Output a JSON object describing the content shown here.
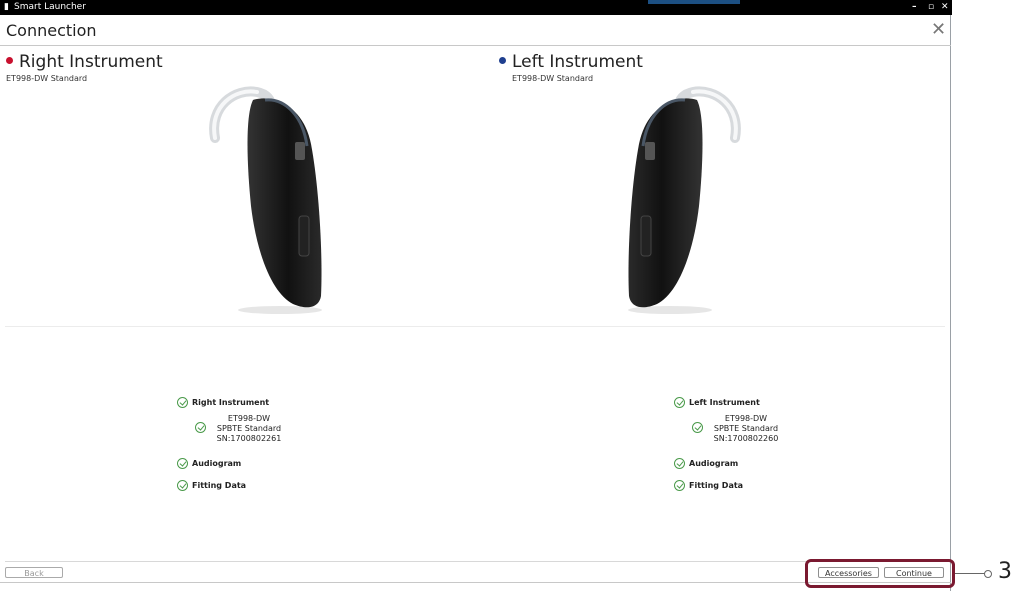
{
  "window": {
    "app_title": "Smart Launcher",
    "minimize": "–",
    "maximize": "▫",
    "close": "✕"
  },
  "header": {
    "title": "Connection",
    "close": "✕"
  },
  "right": {
    "heading": "Right Instrument",
    "model": "ET998-DW  Standard",
    "dot_color": "#c8102e",
    "status": {
      "instrument_label": "Right Instrument",
      "detail_1": "ET998-DW",
      "detail_2": "SPBTE Standard",
      "detail_3": "SN:1700802261",
      "audiogram_label": "Audiogram",
      "fitting_label": "Fitting Data"
    }
  },
  "left": {
    "heading": "Left Instrument",
    "model": "ET998-DW  Standard",
    "dot_color": "#1f3f8f",
    "status": {
      "instrument_label": "Left Instrument",
      "detail_1": "ET998-DW",
      "detail_2": "SPBTE Standard",
      "detail_3": "SN:1700802260",
      "audiogram_label": "Audiogram",
      "fitting_label": "Fitting Data"
    }
  },
  "footer": {
    "back_label": "Back",
    "accessories_label": "Accessories",
    "continue_label": "Continue"
  },
  "callout": {
    "number": "3"
  },
  "colors": {
    "check": "#4a9a4a",
    "highlight": "#7a1930"
  }
}
